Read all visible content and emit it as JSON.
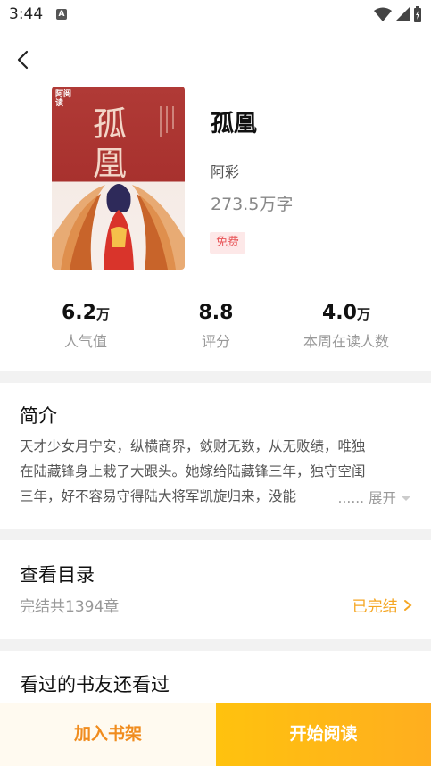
{
  "status_bar": {
    "time": "3:44",
    "app_icon_letter": "A"
  },
  "book": {
    "title": "孤凰",
    "author": "阿彩",
    "word_count": "273.5万字",
    "badge": "免费",
    "cover": {
      "title": "孤凰",
      "publisher_logo": "阿阅读"
    }
  },
  "stats": [
    {
      "value": "6.2",
      "unit": "万",
      "label": "人气值"
    },
    {
      "value": "8.8",
      "unit": "",
      "label": "评分"
    },
    {
      "value": "4.0",
      "unit": "万",
      "label": "本周在读人数"
    }
  ],
  "intro": {
    "heading": "简介",
    "lines": [
      "天才少女月宁安，纵横商界，敛财无数，从无败绩，唯独",
      "在陆藏锋身上栽了大跟头。她嫁给陆藏锋三年，独守空闺",
      "三年，好不容易守得陆大将军凯旋归来，没能"
    ],
    "ellipsis": "......",
    "expand_label": "展开"
  },
  "catalog": {
    "heading": "查看目录",
    "chapters": "完结共1394章",
    "status_label": "已完结"
  },
  "recommend": {
    "heading": "看过的书友还看过"
  },
  "actions": {
    "add_shelf": "加入书架",
    "start_read": "开始阅读"
  },
  "colors": {
    "accent": "#f5a623",
    "badge_text": "#e8575a",
    "badge_bg": "#fde8e8",
    "cover_red": "#b03a36"
  }
}
